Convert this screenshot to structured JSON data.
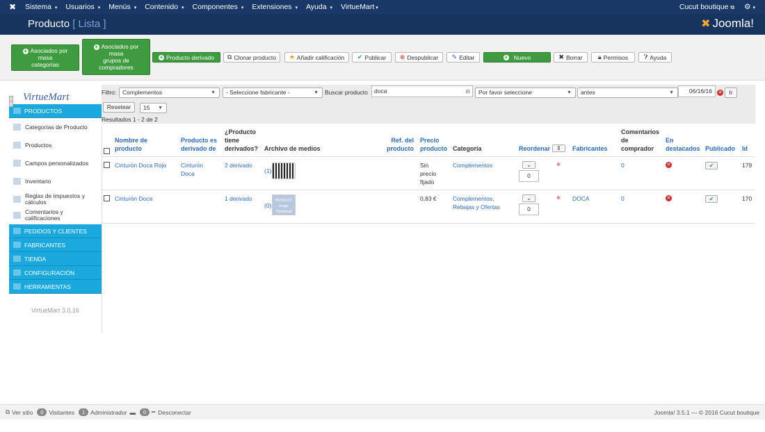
{
  "topmenu": {
    "items": [
      "Sistema",
      "Usuarios",
      "Menús",
      "Contenido",
      "Componentes",
      "Extensiones",
      "Ayuda",
      "VirtueMart"
    ],
    "site_name": "Cucut boutique",
    "caret": "▾",
    "external_icon": "external-link-icon",
    "gear_icon": "gear-icon"
  },
  "title": {
    "main": "Producto",
    "sub": "[ Lista ]",
    "brand": "Joomla!"
  },
  "toolbar": {
    "btn_mass_cat": "Asociados por masa categorías",
    "btn_mass_group_1": "Asociados por",
    "btn_mass_group_2": "masa",
    "btn_mass_group_3": "grupos de",
    "btn_mass_group_4": "compradores",
    "btn_mass_cat_1": "Asociados por",
    "btn_mass_cat_2": "masa",
    "btn_mass_cat_3": "categorías",
    "btn_child": "Producto derivado",
    "btn_clone": "Clonar producto",
    "btn_rating": "Añadir calificación",
    "btn_publish": "Publicar",
    "btn_unpublish": "Despublicar",
    "btn_edit": "Editar",
    "btn_new": "Nuevo",
    "btn_delete": "Borrar",
    "btn_perms": "Permisos",
    "btn_help": "Ayuda"
  },
  "sidebar": {
    "logo": "VirtueMart",
    "tab_label": "‹",
    "sec_products": "PRODUCTOS",
    "items": [
      "Categorías de Producto",
      "Productos",
      "Campos personalizados",
      "Inventario",
      "Reglas de impuestos y cálculos",
      "Comentarios y calificaciones"
    ],
    "item_tax_1": "Reglas de impuestos y",
    "item_tax_2": "cálculos",
    "item_rev_1": "Comentarios y",
    "item_rev_2": "calificaciones",
    "sections": [
      "PEDIDOS Y CLIENTES",
      "FABRICANTES",
      "TIENDA",
      "CONFIGURACIÓN",
      "HERRAMIENTAS"
    ],
    "version": "VirtueMart 3.0.16"
  },
  "filter": {
    "filter_label": "Filtro:",
    "category": "Complementos",
    "manufacturer": "- Seleccione fabricante -",
    "search_label": "Buscar producto",
    "search_value": "doca",
    "status_select": "Por favor seleccione",
    "date_mode": "antes",
    "date_value": "06/16/16",
    "go_label": "Ir",
    "reset_label": "Resetear",
    "limit": "15",
    "results": "Resultados 1 - 2 de 2"
  },
  "table": {
    "headers": {
      "name_1": "Nombre de",
      "name_2": "producto",
      "parent_1": "Producto es",
      "parent_2": "derivado de",
      "haschild_1": "¿Producto",
      "haschild_2": "tiene",
      "haschild_3": "derivados?",
      "media": "Archivo de medios",
      "sku_1": "Ref. del",
      "sku_2": "producto",
      "price_1": "Precio",
      "price_2": "producto",
      "category": "Categoría",
      "order": "Reordenar",
      "manufacturer": "Fabricantes",
      "reviews_1": "Comentarios",
      "reviews_2": "de",
      "reviews_3": "comprador",
      "featured_1": "En",
      "featured_2": "destacados",
      "published": "Publicado",
      "id": "Id"
    },
    "rows": [
      {
        "name": "Cinturón Doca Rojo",
        "parent_1": "Cinturón",
        "parent_2": "Doca",
        "children": "2 derivado",
        "media_count": "(1)",
        "sku": "",
        "price_1": "Sin",
        "price_2": "precio",
        "price_3": "fijado",
        "category_1": "Complementos",
        "category_2": "",
        "order": "0",
        "manufacturer": "",
        "reviews": "0",
        "id": "179"
      },
      {
        "name": "Cinturón Doca",
        "parent_1": "",
        "parent_2": "",
        "children": "1 derivado",
        "media_count": "(0)",
        "noimage_1": "PRODUCT",
        "noimage_2": "Image",
        "noimage_3": "Thumbnail",
        "sku": "",
        "price_1": "0,83 €",
        "price_2": "",
        "price_3": "",
        "category_1": "Complementos,",
        "category_2": "Rebajas y Ofertas",
        "order": "0",
        "manufacturer": "DOCA",
        "reviews": "0",
        "id": "170"
      }
    ]
  },
  "status": {
    "view_site": "Ver sitio",
    "visitors_count": "0",
    "visitors_label": "Visitantes",
    "admin_count": "1",
    "admin_label": "Administrador",
    "msg_count": "0",
    "logout_label": "Desconectar",
    "footer": "Joomla! 3.5.1 — © 2016 Cucut boutique"
  },
  "colors": {
    "topbar": "#1a3867",
    "titlebar": "#17345f",
    "green": "#3f9b3f",
    "sidebar_section": "#1ba8de",
    "link": "#2a69b8"
  }
}
